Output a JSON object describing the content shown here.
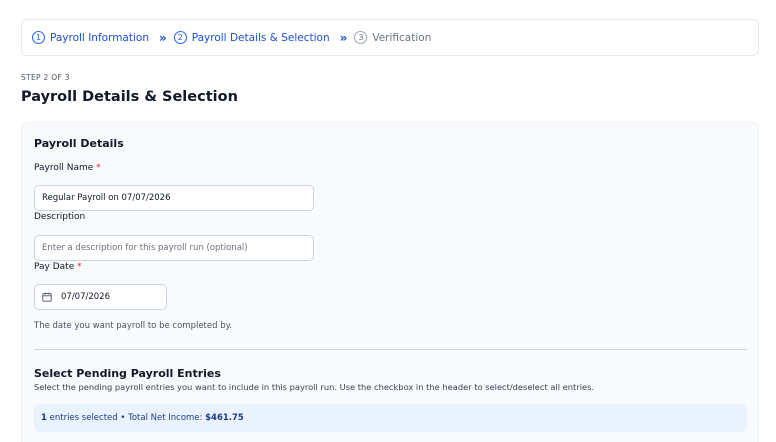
{
  "stepper": {
    "steps": [
      {
        "num": "1",
        "label": "Payroll Information"
      },
      {
        "num": "2",
        "label": "Payroll Details & Selection"
      },
      {
        "num": "3",
        "label": "Verification"
      }
    ],
    "separator": "»"
  },
  "page": {
    "step_count": "STEP 2 OF 3",
    "title": "Payroll Details & Selection"
  },
  "details": {
    "section_title": "Payroll Details",
    "payroll_name_label": "Payroll Name",
    "required_mark": "*",
    "payroll_name_value": "Regular Payroll on 07/07/2026",
    "description_label": "Description",
    "description_placeholder": "Enter a description for this payroll run (optional)",
    "pay_date_label": "Pay Date",
    "pay_date_value": "07/07/2026",
    "pay_date_hint": "The date you want payroll to be completed by."
  },
  "entries": {
    "title": "Select Pending Payroll Entries",
    "description": "Select the pending payroll entries you want to include in this payroll run. Use the checkbox in the header to select/deselect all entries.",
    "selected_count": "1",
    "selected_text": "entries selected • Total Net Income:",
    "total_net_income": "$461.75"
  }
}
